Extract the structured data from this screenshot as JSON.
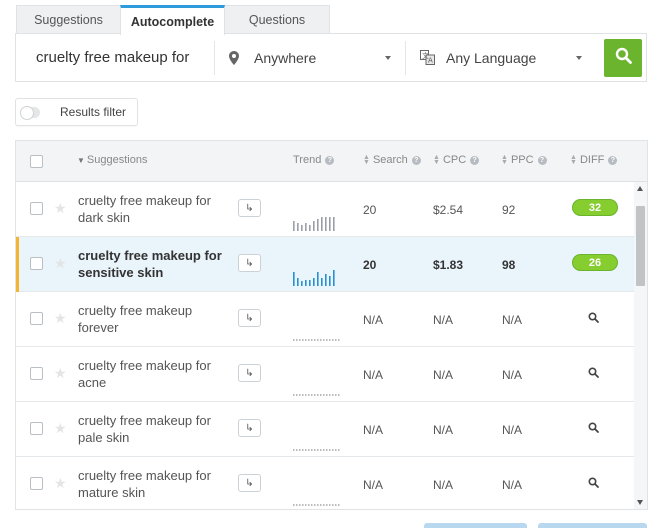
{
  "tabs": [
    {
      "label": "Suggestions",
      "active": false
    },
    {
      "label": "Autocomplete",
      "active": true
    },
    {
      "label": "Questions",
      "active": false
    }
  ],
  "search": {
    "keyword": "cruelty free makeup for",
    "location": "Anywhere",
    "language": "Any Language"
  },
  "filter": {
    "label": "Results filter"
  },
  "table": {
    "headers": {
      "suggestions": "Suggestions",
      "trend": "Trend",
      "search": "Search",
      "cpc": "CPC",
      "ppc": "PPC",
      "diff": "DIFF"
    },
    "rows": [
      {
        "keyword": "cruelty free makeup for dark skin",
        "search": "20",
        "cpc": "$2.54",
        "ppc": "92",
        "diff": "32",
        "trend": [
          10,
          8,
          6,
          8,
          6,
          10,
          12,
          14,
          14,
          14,
          14,
          0
        ],
        "selected": false
      },
      {
        "keyword": "cruelty free makeup for sensitive skin",
        "search": "20",
        "cpc": "$1.83",
        "ppc": "98",
        "diff": "26",
        "trend": [
          14,
          8,
          5,
          6,
          6,
          8,
          14,
          8,
          12,
          10,
          16,
          0
        ],
        "selected": true
      },
      {
        "keyword": "cruelty free makeup forever",
        "search": "N/A",
        "cpc": "N/A",
        "ppc": "N/A",
        "diff": "",
        "trend": [],
        "selected": false
      },
      {
        "keyword": "cruelty free makeup for acne",
        "search": "N/A",
        "cpc": "N/A",
        "ppc": "N/A",
        "diff": "",
        "trend": [],
        "selected": false
      },
      {
        "keyword": "cruelty free makeup for pale skin",
        "search": "N/A",
        "cpc": "N/A",
        "ppc": "N/A",
        "diff": "",
        "trend": [],
        "selected": false
      },
      {
        "keyword": "cruelty free makeup for mature skin",
        "search": "N/A",
        "cpc": "N/A",
        "ppc": "N/A",
        "diff": "",
        "trend": [],
        "selected": false
      }
    ]
  },
  "colors": {
    "accent": "#2e9cdb",
    "search_button": "#6ab42e",
    "diff_easy": "#86cd2f",
    "selected_row": "#eaf4fb",
    "selected_marker": "#f2b632",
    "trend_gray": "#9aa0a6",
    "trend_blue": "#2a8fd0"
  },
  "icons": {
    "location": "location-pin-icon",
    "language": "translate-icon",
    "search": "magnifier-icon",
    "star": "star-icon",
    "use": "arrow-return-icon"
  }
}
